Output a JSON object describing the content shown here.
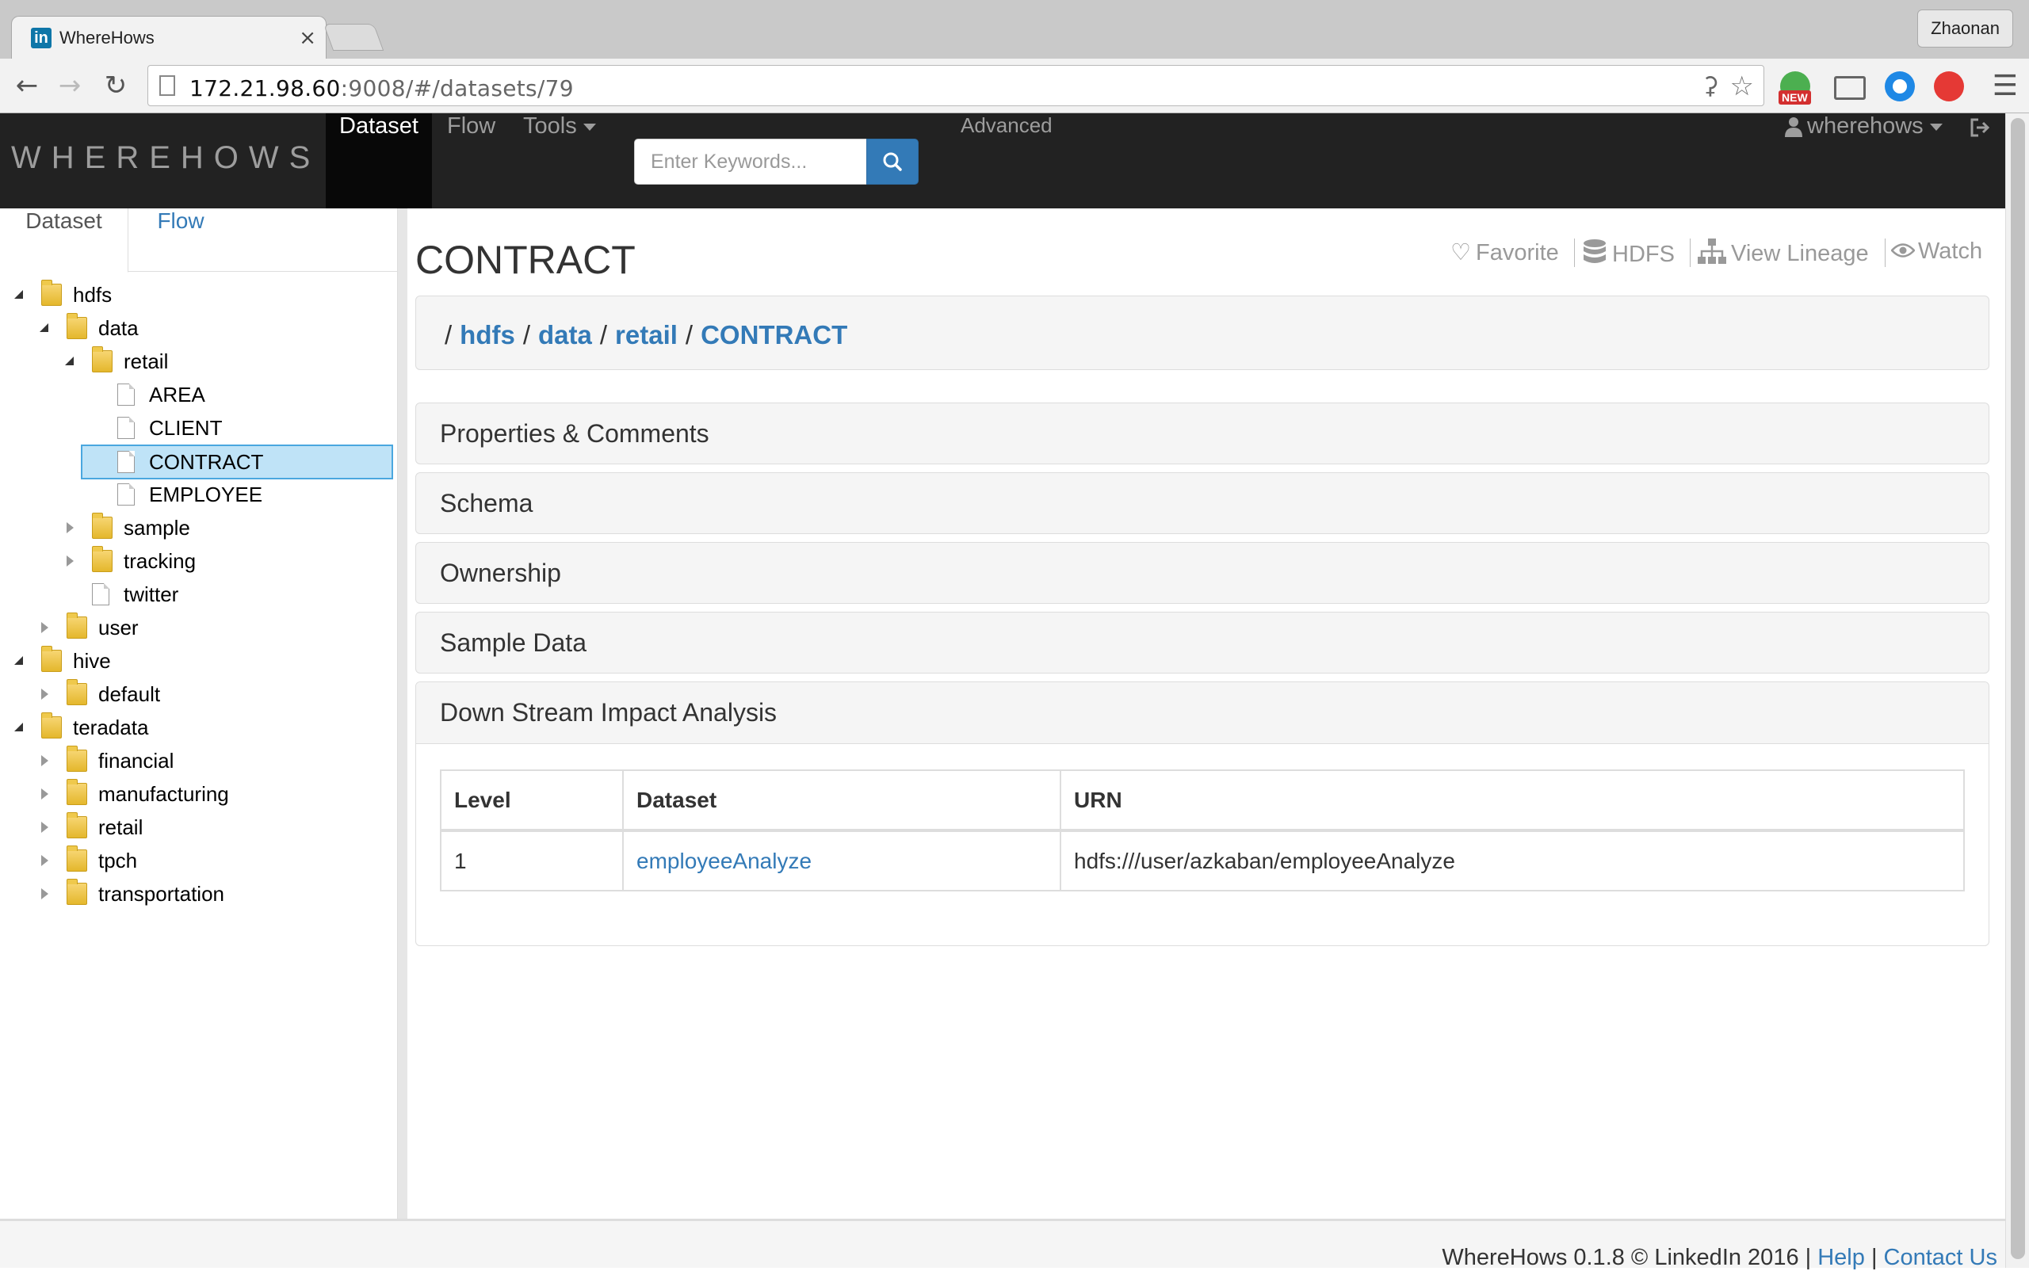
{
  "browser": {
    "tab_title": "WhereHows",
    "tab_favicon": "in",
    "tab_close": "×",
    "profile_name": "Zhaonan",
    "url_host": "172.21.98.60",
    "url_rest": ":9008/#/datasets/79",
    "ext_new_badge": "NEW",
    "icons": [
      "back-icon",
      "forward-icon",
      "reload-icon",
      "page-icon",
      "key-icon",
      "star-icon",
      "cast-icon",
      "menu-icon"
    ]
  },
  "navbar": {
    "brand": "WHEREHOWS",
    "items": [
      {
        "label": "Dataset",
        "active": true
      },
      {
        "label": "Flow",
        "active": false
      },
      {
        "label": "Tools",
        "active": false
      }
    ],
    "search_placeholder": "Enter Keywords...",
    "advanced": "Advanced",
    "user": "wherehows"
  },
  "sidebar": {
    "tabs": [
      "Dataset",
      "Flow"
    ],
    "tree": [
      {
        "label": "hdfs",
        "type": "folder",
        "state": "open"
      },
      {
        "label": "data",
        "type": "folder",
        "state": "open"
      },
      {
        "label": "retail",
        "type": "folder",
        "state": "open"
      },
      {
        "label": "AREA",
        "type": "file"
      },
      {
        "label": "CLIENT",
        "type": "file"
      },
      {
        "label": "CONTRACT",
        "type": "file",
        "selected": true
      },
      {
        "label": "EMPLOYEE",
        "type": "file"
      },
      {
        "label": "sample",
        "type": "folder",
        "state": "closed"
      },
      {
        "label": "tracking",
        "type": "folder",
        "state": "closed"
      },
      {
        "label": "twitter",
        "type": "file"
      },
      {
        "label": "user",
        "type": "folder",
        "state": "closed"
      },
      {
        "label": "hive",
        "type": "folder",
        "state": "open"
      },
      {
        "label": "default",
        "type": "folder",
        "state": "closed"
      },
      {
        "label": "teradata",
        "type": "folder",
        "state": "open"
      },
      {
        "label": "financial",
        "type": "folder",
        "state": "closed"
      },
      {
        "label": "manufacturing",
        "type": "folder",
        "state": "closed"
      },
      {
        "label": "retail",
        "type": "folder",
        "state": "closed"
      },
      {
        "label": "tpch",
        "type": "folder",
        "state": "closed"
      },
      {
        "label": "transportation",
        "type": "folder",
        "state": "closed"
      }
    ]
  },
  "main": {
    "title": "CONTRACT",
    "actions": {
      "favorite": "Favorite",
      "hdfs": "HDFS",
      "lineage": "View Lineage",
      "watch": "Watch"
    },
    "breadcrumb": [
      "hdfs",
      "data",
      "retail",
      "CONTRACT"
    ],
    "panels": [
      "Properties & Comments",
      "Schema",
      "Ownership",
      "Sample Data"
    ],
    "impact": {
      "title": "Down Stream Impact Analysis",
      "columns": [
        "Level",
        "Dataset",
        "URN"
      ],
      "rows": [
        {
          "level": "1",
          "dataset": "employeeAnalyze",
          "urn": "hdfs:///user/azkaban/employeeAnalyze"
        }
      ]
    }
  },
  "footer": {
    "text": "WhereHows 0.1.8 © LinkedIn 2016",
    "help": "Help",
    "contact": "Contact Us"
  }
}
